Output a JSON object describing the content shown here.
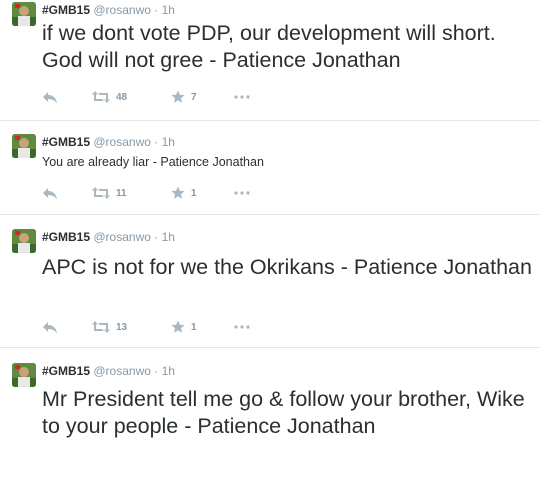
{
  "tweets": [
    {
      "name": "#GMB15",
      "handle": "@rosanwo",
      "separator": "·",
      "time": "1h",
      "text": "if we dont vote PDP, our development will short. God will not gree - Patience Jonathan",
      "retweets": "48",
      "favorites": "7"
    },
    {
      "name": "#GMB15",
      "handle": "@rosanwo",
      "separator": "·",
      "time": "1h",
      "text": "You are already liar - Patience Jonathan",
      "retweets": "11",
      "favorites": "1"
    },
    {
      "name": "#GMB15",
      "handle": "@rosanwo",
      "separator": "·",
      "time": "1h",
      "text": "APC is not for we the Okrikans - Patience Jonathan",
      "retweets": "13",
      "favorites": "1"
    },
    {
      "name": "#GMB15",
      "handle": "@rosanwo",
      "separator": "·",
      "time": "1h",
      "text": "Mr President tell me go & follow your brother, Wike to your people - Patience Jonathan"
    }
  ],
  "icons": {
    "reply": "reply-icon",
    "retweet": "retweet-icon",
    "favorite": "star-icon",
    "more": "more-icon"
  },
  "colors": {
    "text": "#292f33",
    "muted": "#8899a6",
    "icon": "#aab8c2",
    "divider": "#e1e8ed"
  }
}
